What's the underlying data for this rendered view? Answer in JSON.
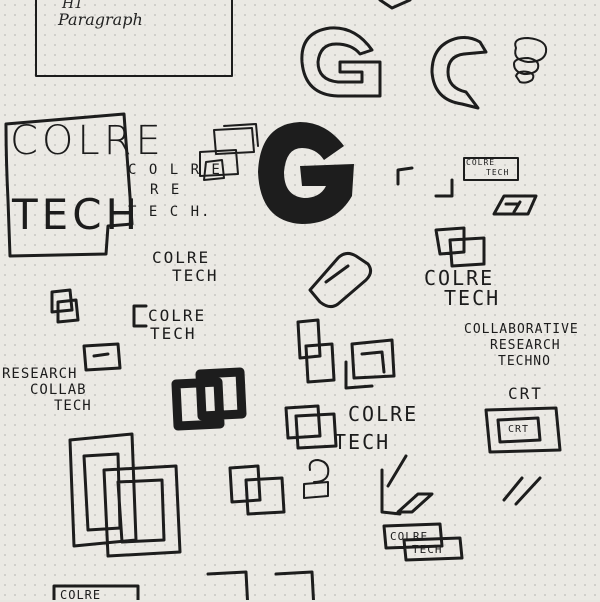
{
  "notes": {
    "heading": "H1",
    "paragraph": "Paragraph"
  },
  "wordmarks": {
    "colre_tech_box_top": "COLRE",
    "colre_tech_box_bottom": "TECH",
    "colre_tech_stacked": [
      "C O L R E",
      "R E",
      "T E C H."
    ],
    "colre_tech_mid_top": "COLRE",
    "colre_tech_mid_bottom": "TECH",
    "colre_tech_small_top": "COLRE",
    "colre_tech_small_bottom": "TECH",
    "colre_tech_right_top": "COLRE",
    "colre_tech_right_bottom": "TECH",
    "colre_tech_center_top": "COLRE",
    "colre_tech_center_bottom": "TECH",
    "collaborative_lines": [
      "COLLABORATIVE",
      "RESEARCH",
      "TECHNO"
    ],
    "research_collab_tech": [
      "RESEARCH",
      "COLLAB",
      "TECH"
    ],
    "crt": "CRT",
    "crt_box": "CRT",
    "badge_top": "COLRE",
    "badge_bottom": "TECH",
    "mini_badge_top": "COLRE",
    "mini_badge_bottom": "TECH",
    "bottom_box": "COLRE"
  },
  "colors": {
    "paper": "#ebe9e4",
    "ink": "#1d1d1d"
  }
}
